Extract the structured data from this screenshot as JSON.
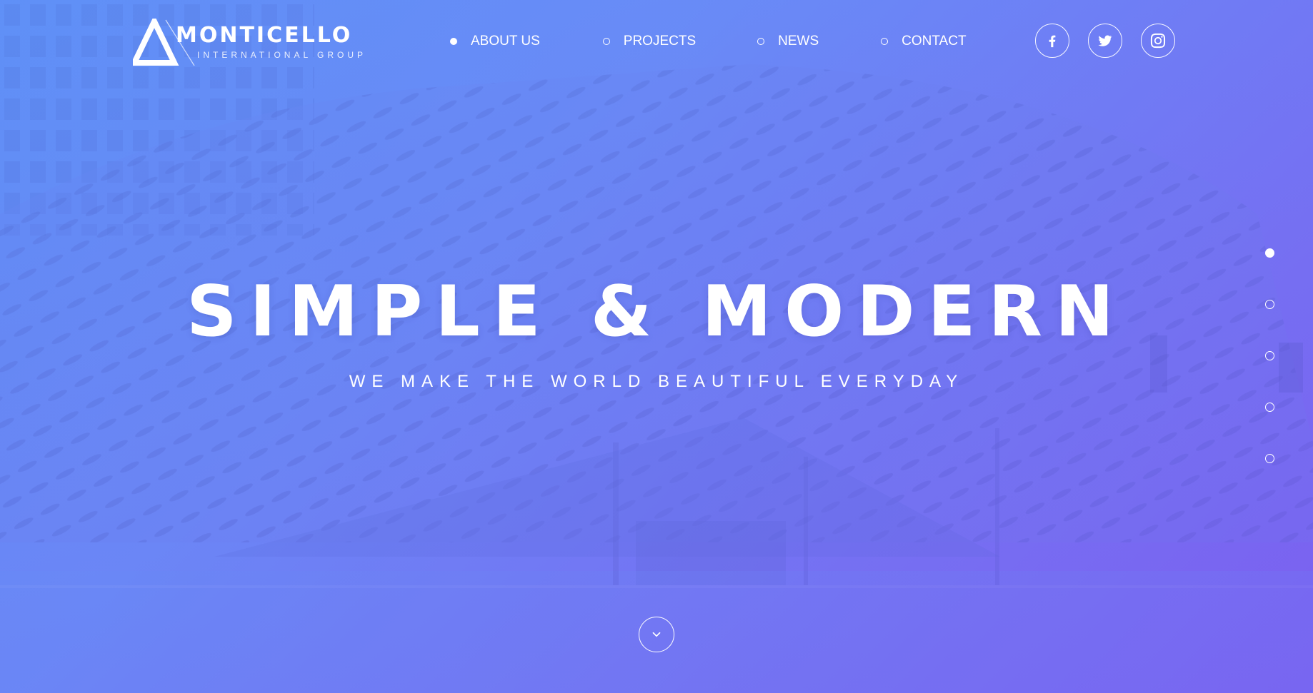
{
  "brand": {
    "name": "MONTICELLO",
    "tagline": "INTERNATIONAL GROUP"
  },
  "nav": {
    "items": [
      {
        "label": "ABOUT US",
        "active": true
      },
      {
        "label": "PROJECTS",
        "active": false
      },
      {
        "label": "NEWS",
        "active": false
      },
      {
        "label": "CONTACT",
        "active": false
      }
    ]
  },
  "social": {
    "icons": [
      "facebook-icon",
      "twitter-icon",
      "instagram-icon"
    ]
  },
  "hero": {
    "title": "SIMPLE & MODERN",
    "subtitle": "WE MAKE THE WORLD BEAUTIFUL EVERYDAY"
  },
  "pager": {
    "count": 5,
    "active_index": 0
  },
  "colors": {
    "gradient_start": "#5f8df5",
    "gradient_end": "#7b5ff0",
    "text": "#ffffff"
  }
}
